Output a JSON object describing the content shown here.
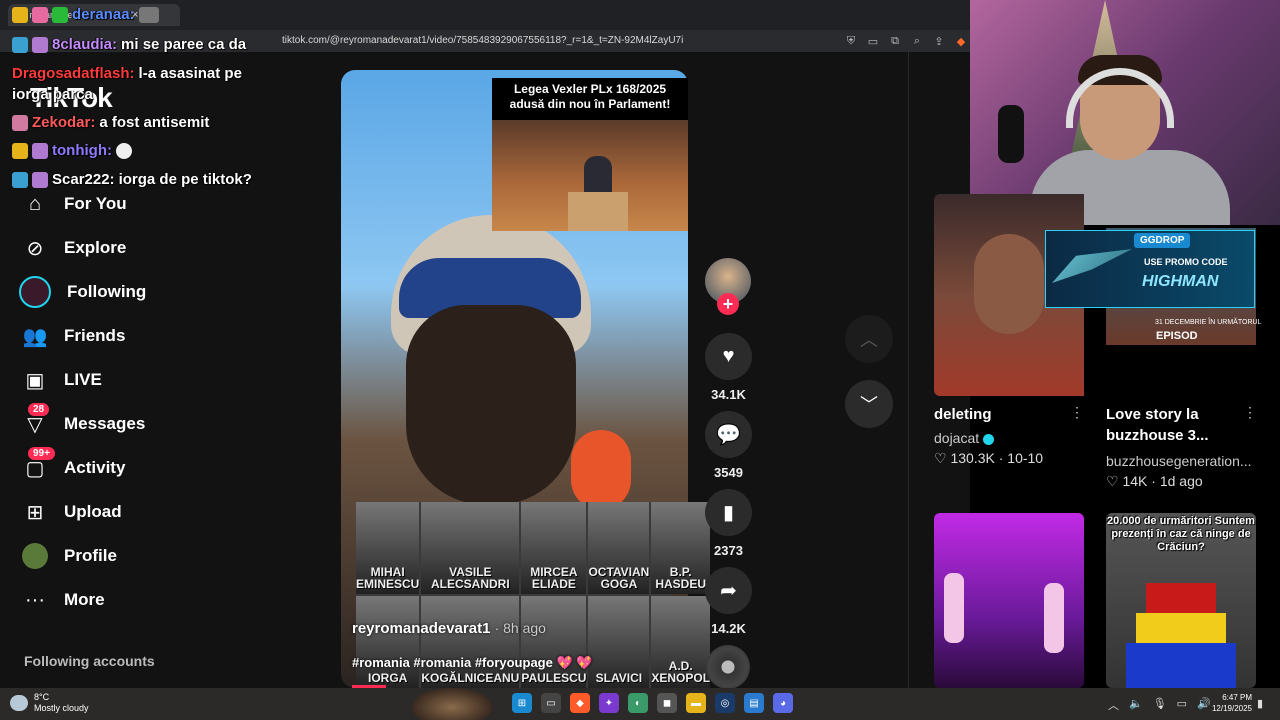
{
  "browser": {
    "tab_title": "(9) romana de...",
    "url": "tiktok.com/@reyromanadevarat1/video/7585483929067556118?_r=1&_t=ZN-92M4lZayU7i"
  },
  "tiktok": {
    "logo": "TikTok",
    "nav": [
      {
        "label": "For You",
        "icon": "home-icon"
      },
      {
        "label": "Explore",
        "icon": "compass-icon"
      },
      {
        "label": "Following",
        "icon": "following-avatar-icon"
      },
      {
        "label": "Friends",
        "icon": "friends-icon"
      },
      {
        "label": "LIVE",
        "icon": "live-icon"
      },
      {
        "label": "Messages",
        "icon": "messages-icon",
        "badge": "28"
      },
      {
        "label": "Activity",
        "icon": "activity-icon",
        "badge": "99+"
      },
      {
        "label": "Upload",
        "icon": "upload-icon"
      },
      {
        "label": "Profile",
        "icon": "profile-avatar-icon"
      },
      {
        "label": "More",
        "icon": "more-dots-icon"
      }
    ],
    "following_accounts_label": "Following accounts"
  },
  "chat": [
    {
      "user": "deranaa:",
      "message": "",
      "user_color": "#5b8cff"
    },
    {
      "user": "8claudia:",
      "message": "mi se paree ca da",
      "user_color": "#c58bff"
    },
    {
      "user": "Dragosadatflash:",
      "message": "l-a asasinat pe",
      "user_color": "#ff3b3b"
    },
    {
      "user": "",
      "message": "iorga parca",
      "user_color": "#ffffff"
    },
    {
      "user": "Zekodar:",
      "message": "a fost antisemit",
      "user_color": "#ff5a5a"
    },
    {
      "user": "tonhigh:",
      "message": "",
      "user_color": "#8f7bff"
    },
    {
      "user": "Scar222:",
      "message": "iorga de pe tiktok?",
      "user_color": "#ffffff"
    }
  ],
  "video": {
    "inset_caption_line1": "Legea Vexler PLx 168/2025",
    "inset_caption_line2": "adusă din nou în Parlament!",
    "portraits": [
      "MIHAI EMINESCU",
      "VASILE ALECSANDRI",
      "MIRCEA ELIADE",
      "OCTAVIAN GOGA",
      "B.P. HASDEU",
      "IORGA",
      "KOGĂLNICEANU",
      "PAULESCU",
      "SLAVICI",
      "A.D. XENOPOL"
    ],
    "author": "reyromanadevarat1",
    "ago": "· 8h ago",
    "hashtags": "#romania #romania #foryoupage 💖 💖",
    "progress": 0.1
  },
  "actions": {
    "likes": "34.1K",
    "comments": "3549",
    "saves": "2373",
    "shares": "14.2K"
  },
  "feed": [
    {
      "title": "deleting",
      "author": "dojacat",
      "verified": true,
      "likes": "130.3K",
      "date": "10-10"
    },
    {
      "title": "Love story la buzzhouse 3...",
      "author": "buzzhousegeneration...",
      "verified": false,
      "likes": "14K",
      "date": "1d ago"
    }
  ],
  "overlays": {
    "ggdrop_logo": "GGDROP",
    "ggdrop_line1": "USE PROMO CODE",
    "ggdrop_code": "HIGHMAN",
    "buzz_caption": "31 DECEMBRIE ÎN URMĂTORUL",
    "buzz_episode": "EPISOD",
    "flag_caption": "20.000 de urmăritori Suntem prezenți în caz că ninge de Crăciun?"
  },
  "taskbar": {
    "temp": "8°C",
    "weather": "Mostly cloudy",
    "time": "6:47 PM",
    "date": "12/19/2025"
  }
}
